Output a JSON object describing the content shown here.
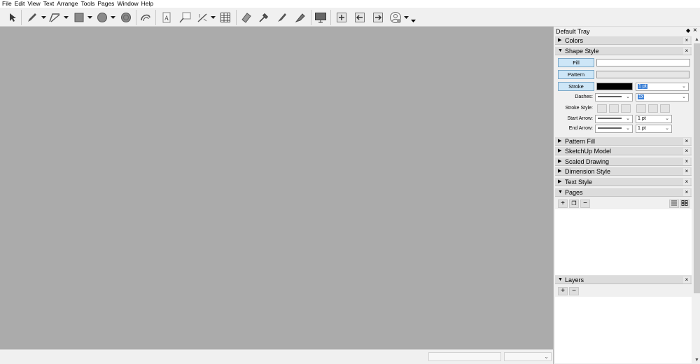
{
  "menu": [
    "File",
    "Edit",
    "View",
    "Text",
    "Arrange",
    "Tools",
    "Pages",
    "Window",
    "Help"
  ],
  "toolbar_icons": [
    "select-icon",
    "pencil-icon",
    "line-dropdown-icon",
    "polyline-icon",
    "polyline-dropdown-icon",
    "rectangle-icon",
    "rectangle-dropdown-icon",
    "circle-icon",
    "circle-dropdown-icon",
    "polygon-icon",
    "offset-icon",
    "text-icon",
    "label-icon",
    "dimension-icon",
    "dimension-dropdown-icon",
    "table-icon",
    "eraser-icon",
    "eyedropper-icon",
    "style-brush-icon",
    "split-icon",
    "presentation-icon",
    "add-page-icon",
    "previous-page-icon",
    "next-page-icon",
    "account-icon",
    "account-dropdown-icon",
    "toolbar-overflow-icon"
  ],
  "tray": {
    "title": "Default Tray",
    "pin": "◆",
    "close": "×",
    "panels": [
      {
        "label": "Colors",
        "state": "collapsed"
      },
      {
        "label": "Shape Style",
        "state": "expanded"
      },
      {
        "label": "Pattern Fill",
        "state": "collapsed"
      },
      {
        "label": "SketchUp Model",
        "state": "collapsed"
      },
      {
        "label": "Scaled Drawing",
        "state": "collapsed"
      },
      {
        "label": "Dimension Style",
        "state": "collapsed"
      },
      {
        "label": "Text Style",
        "state": "collapsed"
      },
      {
        "label": "Pages",
        "state": "expanded"
      },
      {
        "label": "Layers",
        "state": "expanded"
      }
    ],
    "arrow_collapsed": "▶",
    "arrow_expanded": "▼",
    "panel_close": "×"
  },
  "shape_style": {
    "fill_label": "Fill",
    "pattern_label": "Pattern",
    "stroke_label": "Stroke",
    "fill_color": "#ffffff",
    "pattern_color": "#e6e6e6",
    "stroke_color": "#000000",
    "stroke_width": "1 pt",
    "dashes_label": "Dashes:",
    "dash_scale": "1x",
    "stroke_style_label": "Stroke Style:",
    "start_arrow_label": "Start Arrow:",
    "start_arrow_size": "1 pt",
    "end_arrow_label": "End Arrow:",
    "end_arrow_size": "1 pt"
  },
  "pages": {
    "add": "+",
    "duplicate": "❐",
    "remove": "−",
    "list_view_icon": "list-view-icon",
    "thumbnail_view_icon": "thumbnail-view-icon"
  },
  "layers": {
    "add": "+",
    "remove": "−"
  },
  "colors": {
    "canvas": "#ababab",
    "button_highlight": "#cde6f7",
    "selection": "#3a7fd6"
  }
}
